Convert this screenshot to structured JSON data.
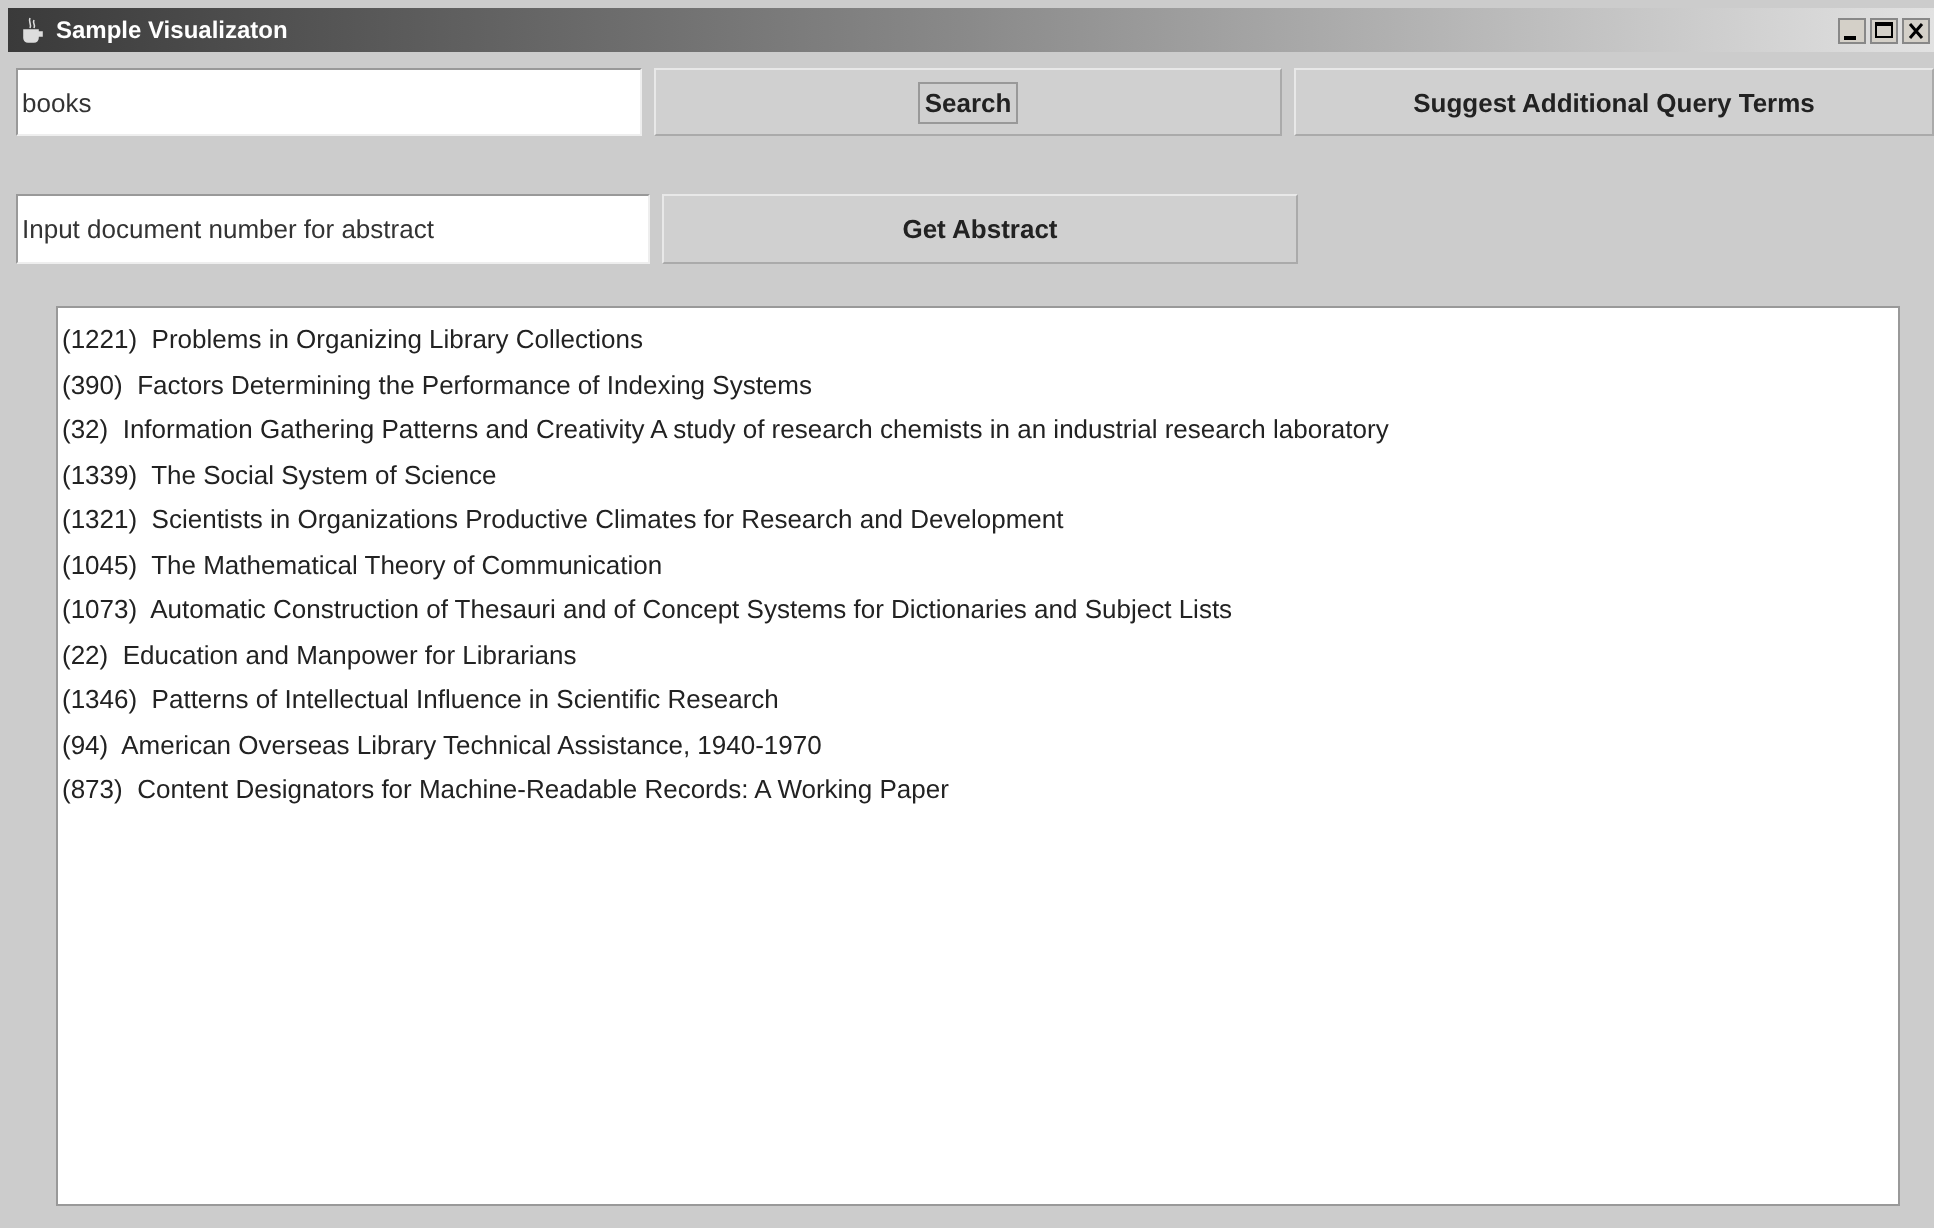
{
  "window": {
    "title": "Sample Visualizaton"
  },
  "query_field": {
    "value": "books"
  },
  "search_button": {
    "label": "Search"
  },
  "suggest_button": {
    "label": "Suggest Additional Query Terms"
  },
  "abstract_field": {
    "value": "Input document number for abstract"
  },
  "abstract_button": {
    "label": "Get Abstract"
  },
  "results": [
    "(1221)  Problems in Organizing Library Collections",
    "(390)  Factors Determining the Performance of Indexing Systems",
    "(32)  Information Gathering Patterns and Creativity A study of research chemists in an industrial research laboratory",
    "(1339)  The Social System of Science",
    "(1321)  Scientists in Organizations Productive Climates for Research and Development",
    "(1045)  The Mathematical Theory of Communication",
    "(1073)  Automatic Construction of Thesauri and of Concept Systems for Dictionaries and Subject Lists",
    "(22)  Education and Manpower for Librarians",
    "(1346)  Patterns of Intellectual Influence in Scientific Research",
    "(94)  American Overseas Library Technical Assistance, 1940-1970",
    "(873)  Content Designators for Machine-Readable Records: A Working Paper"
  ]
}
